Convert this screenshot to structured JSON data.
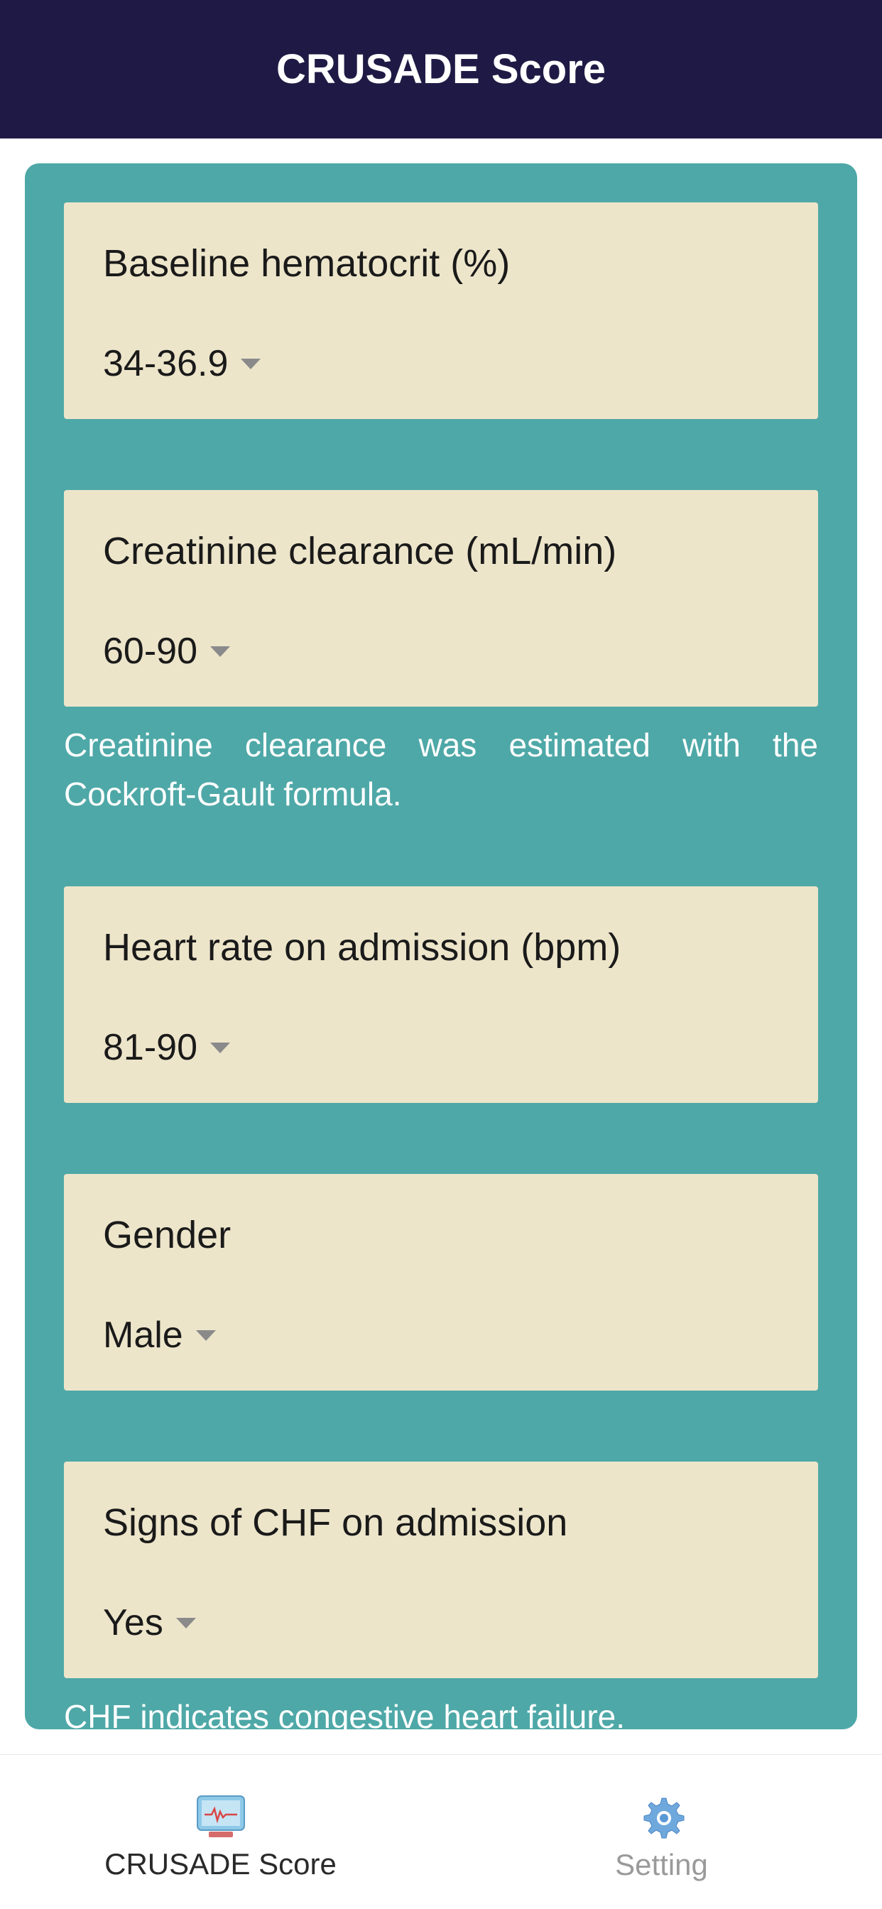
{
  "header": {
    "title": "CRUSADE Score"
  },
  "form": {
    "fields": [
      {
        "label": "Baseline hematocrit (%)",
        "value": "34-36.9",
        "helpText": null
      },
      {
        "label": "Creatinine clearance (mL/min)",
        "value": "60-90",
        "helpText": "Creatinine clearance was estimated with the Cockroft-Gault formula."
      },
      {
        "label": "Heart rate on admission (bpm)",
        "value": "81-90",
        "helpText": null
      },
      {
        "label": "Gender",
        "value": "Male",
        "helpText": null
      },
      {
        "label": "Signs of CHF on admission",
        "value": "Yes",
        "helpText": "CHF indicates congestive heart failure."
      }
    ]
  },
  "bottomNav": {
    "items": [
      {
        "label": "CRUSADE Score",
        "active": true
      },
      {
        "label": "Setting",
        "active": false
      }
    ]
  }
}
